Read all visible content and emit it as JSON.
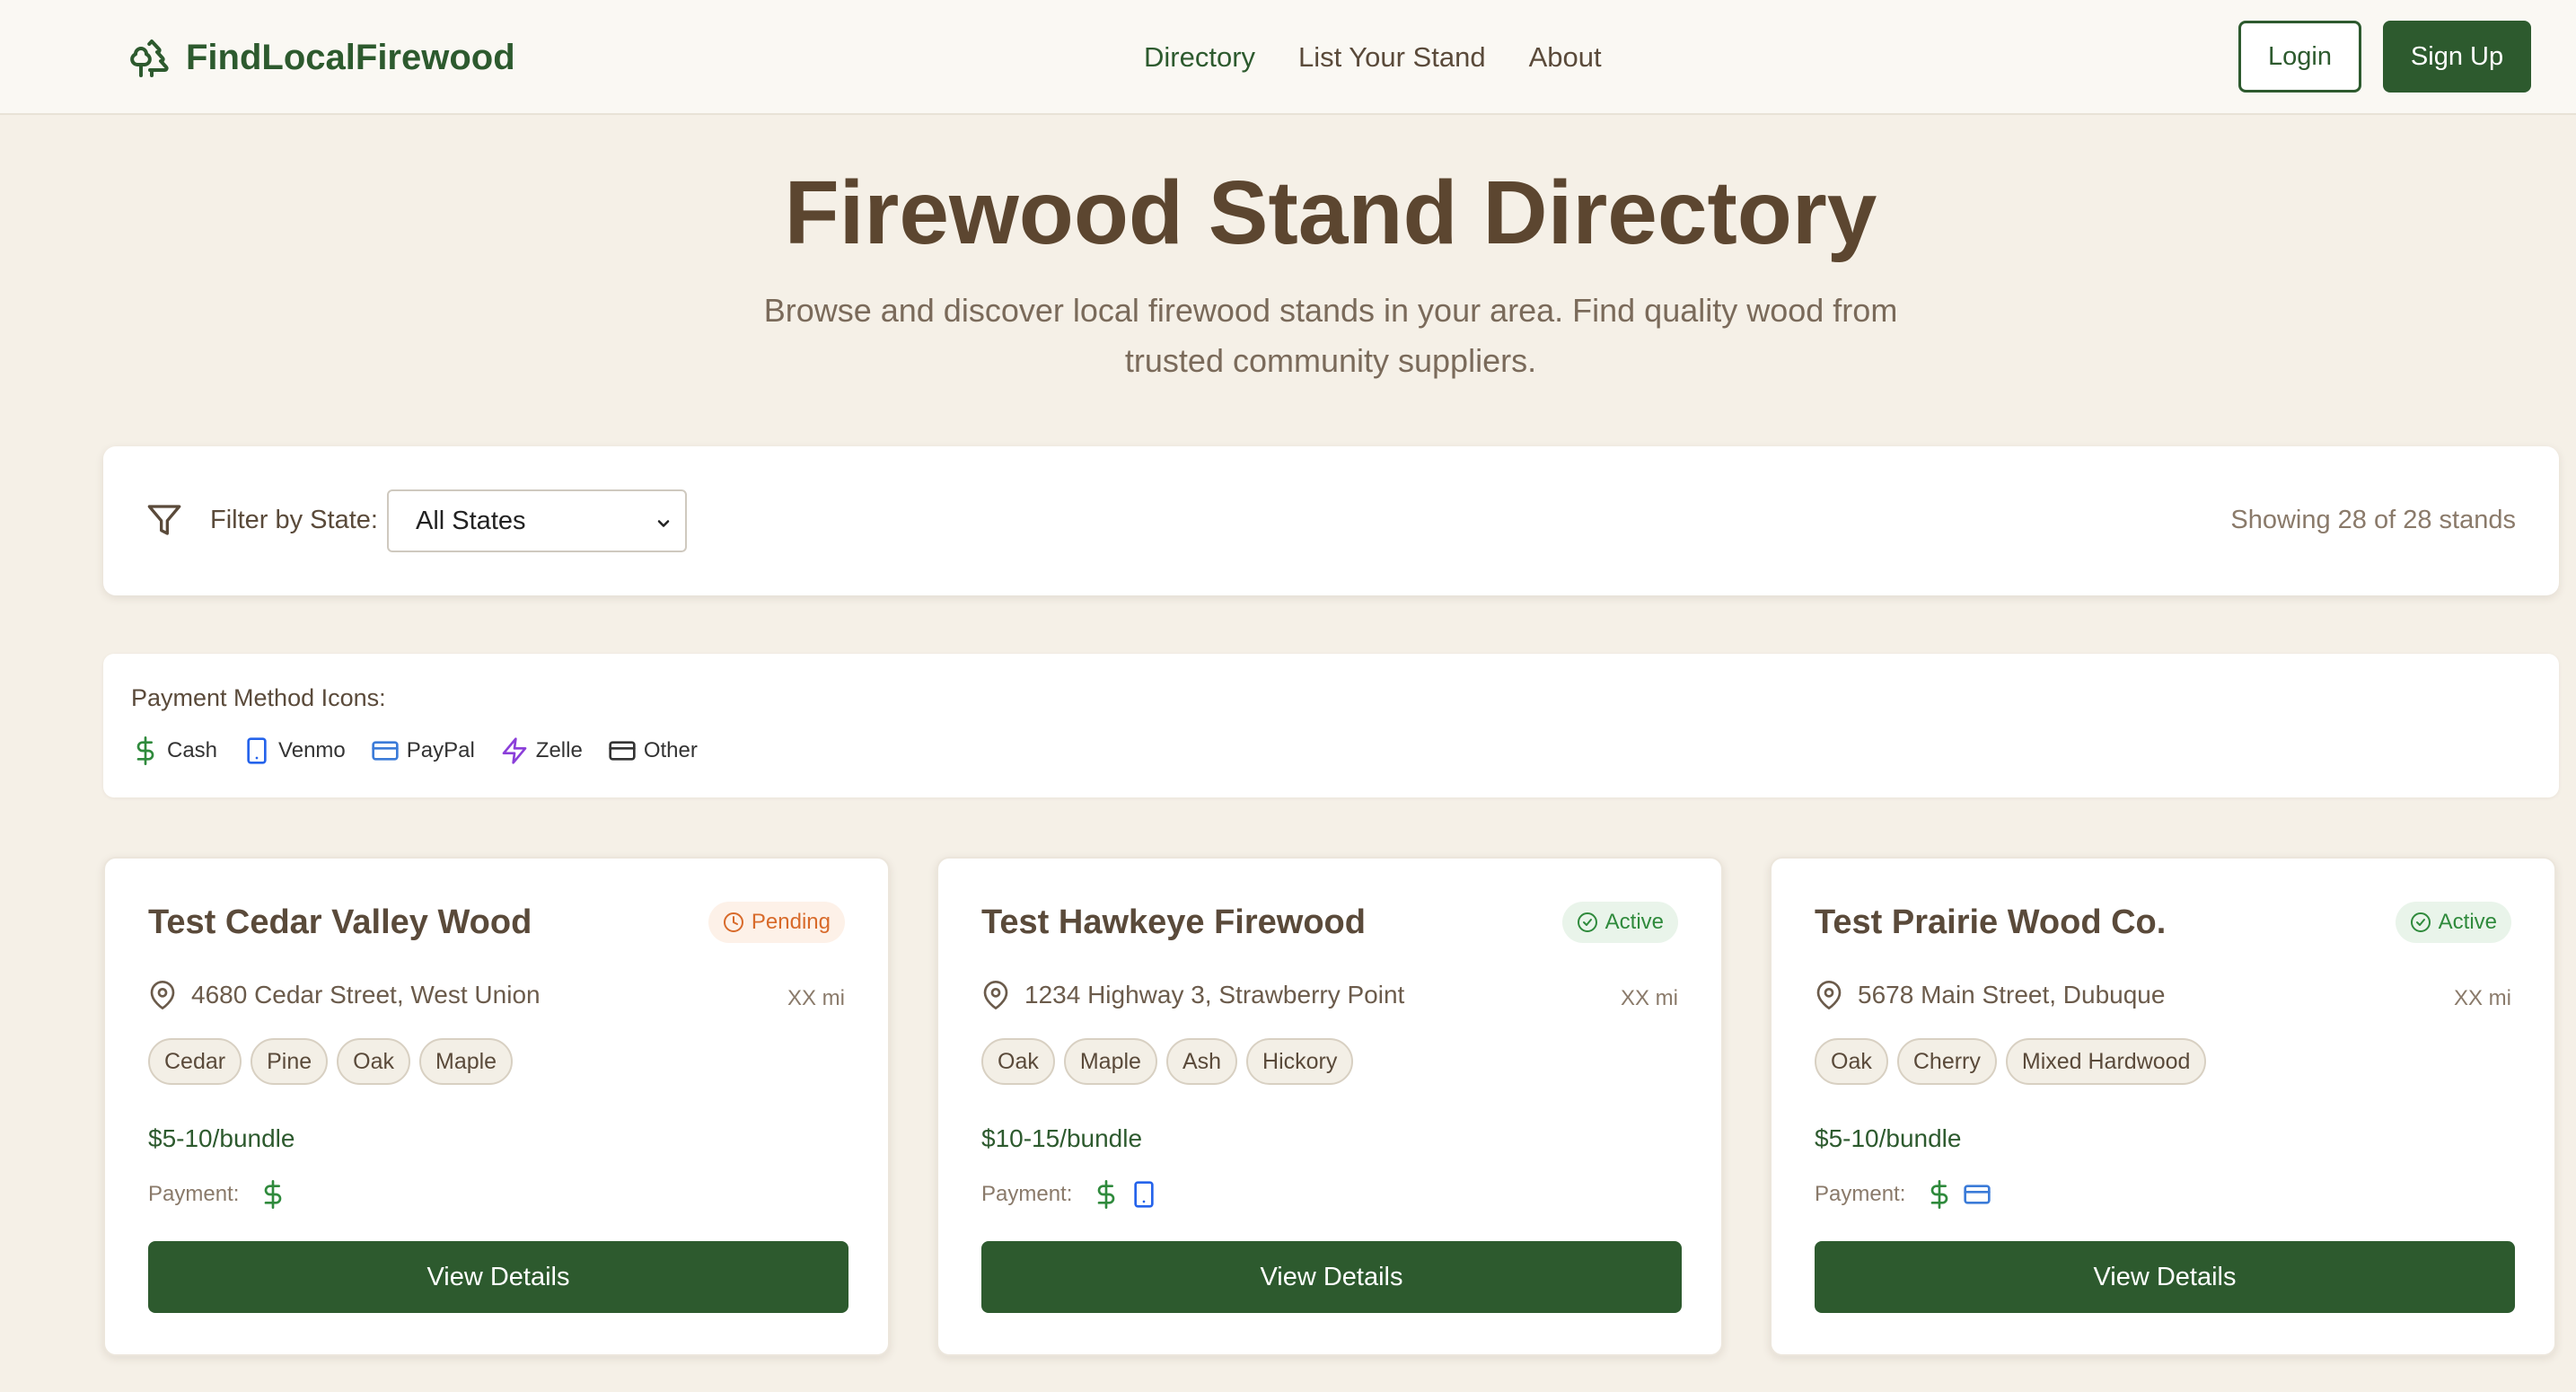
{
  "nav": {
    "brand": "FindLocalFirewood",
    "links": [
      "Directory",
      "List Your Stand",
      "About"
    ],
    "login": "Login",
    "signup": "Sign Up"
  },
  "hero": {
    "title": "Firewood Stand Directory",
    "subtitle_line1": "Browse and discover local firewood stands in your area. Find quality wood from",
    "subtitle_line2": "trusted community suppliers."
  },
  "filter": {
    "label": "Filter by State:",
    "selected": "All States",
    "showing": "Showing 28 of 28 stands"
  },
  "legend": {
    "title": "Payment Method Icons:",
    "items": [
      {
        "label": "Cash",
        "icon": "dollar-icon",
        "color": "#2f8a3c"
      },
      {
        "label": "Venmo",
        "icon": "phone-icon",
        "color": "#2563eb"
      },
      {
        "label": "PayPal",
        "icon": "card-icon",
        "color": "#3b7bd8"
      },
      {
        "label": "Zelle",
        "icon": "bolt-icon",
        "color": "#8b3fd9"
      },
      {
        "label": "Other",
        "icon": "card-icon",
        "color": "#333333"
      }
    ]
  },
  "stands": [
    {
      "name": "Test Cedar Valley Wood",
      "status": "Pending",
      "address": "4680 Cedar Street, West Union",
      "distance": "XX mi",
      "tags": [
        "Cedar",
        "Pine",
        "Oak",
        "Maple"
      ],
      "price": "$5-10/bundle",
      "payment_label": "Payment:",
      "payments": [
        "cash"
      ],
      "button": "View Details"
    },
    {
      "name": "Test Hawkeye Firewood",
      "status": "Active",
      "address": "1234 Highway 3, Strawberry Point",
      "distance": "XX mi",
      "tags": [
        "Oak",
        "Maple",
        "Ash",
        "Hickory"
      ],
      "price": "$10-15/bundle",
      "payment_label": "Payment:",
      "payments": [
        "cash",
        "venmo"
      ],
      "button": "View Details"
    },
    {
      "name": "Test Prairie Wood Co.",
      "status": "Active",
      "address": "5678 Main Street, Dubuque",
      "distance": "XX mi",
      "tags": [
        "Oak",
        "Cherry",
        "Mixed Hardwood"
      ],
      "price": "$5-10/bundle",
      "payment_label": "Payment:",
      "payments": [
        "cash",
        "paypal"
      ],
      "button": "View Details"
    }
  ],
  "colors": {
    "brand": "#2d5a2e",
    "background": "#f5f0e7",
    "pending": "#d86a2a",
    "active": "#2f8a3c"
  }
}
